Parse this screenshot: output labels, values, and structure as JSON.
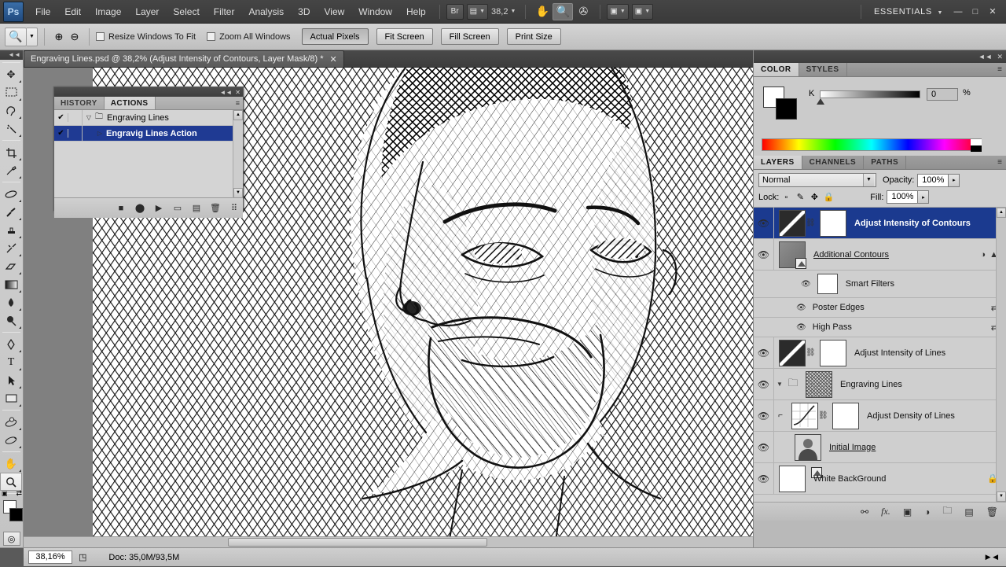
{
  "app": {
    "logo": "Ps",
    "workspace": "ESSENTIALS",
    "zoom_level_top": "38,2",
    "menus": [
      "File",
      "Edit",
      "Image",
      "Layer",
      "Select",
      "Filter",
      "Analysis",
      "3D",
      "View",
      "Window",
      "Help"
    ],
    "bridge_button": "Br",
    "window_buttons": {
      "minimize": "—",
      "maximize": "□",
      "close": "✕"
    }
  },
  "options_bar": {
    "tool": "zoom-tool",
    "checkboxes": [
      {
        "label": "Resize Windows To Fit",
        "checked": false
      },
      {
        "label": "Zoom All Windows",
        "checked": false
      }
    ],
    "buttons": [
      "Actual Pixels",
      "Fit Screen",
      "Fill Screen",
      "Print Size"
    ],
    "pressed_button": "Actual Pixels"
  },
  "document": {
    "tab_title": "Engraving Lines.psd @ 38,2% (Adjust Intensity of Contours, Layer Mask/8) *",
    "close_glyph": "✕"
  },
  "actions_panel": {
    "tabs": [
      {
        "label": "HISTORY",
        "active": false
      },
      {
        "label": "ACTIONS",
        "active": true
      }
    ],
    "rows": [
      {
        "checked": "✔",
        "label": "Engraving Lines",
        "type": "set",
        "selected": false,
        "triangle": "▽"
      },
      {
        "checked": "✔",
        "label": "Engravig Lines Action",
        "type": "action",
        "selected": true,
        "triangle": "▷"
      }
    ],
    "footer_icons": [
      "stop-icon",
      "record-icon",
      "play-icon",
      "new-set-icon",
      "new-action-icon",
      "delete-icon"
    ],
    "menu_glyph": "≡"
  },
  "color_panel": {
    "tabs": [
      {
        "label": "COLOR",
        "active": true
      },
      {
        "label": "STYLES",
        "active": false
      }
    ],
    "channel_label": "K",
    "channel_value": "0",
    "percent_symbol": "%",
    "foreground": "#ffffff",
    "background": "#000000",
    "menu_glyph": "≡"
  },
  "layers_panel": {
    "tabs": [
      {
        "label": "LAYERS",
        "active": true
      },
      {
        "label": "CHANNELS",
        "active": false
      },
      {
        "label": "PATHS",
        "active": false
      }
    ],
    "blend_mode": "Normal",
    "opacity_label": "Opacity:",
    "opacity_value": "100%",
    "lock_label": "Lock:",
    "fill_label": "Fill:",
    "fill_value": "100%",
    "lock_icons": [
      "lock-transparent-icon",
      "lock-paint-icon",
      "lock-move-icon",
      "lock-all-icon"
    ],
    "menu_glyph": "≡",
    "layers": [
      {
        "name": "Adjust Intensity of Contours",
        "kind": "adjustment",
        "selected": true,
        "visible": true,
        "has_mask": true,
        "linked": true,
        "indent": 0,
        "underline": false
      },
      {
        "name": "Additional Contours",
        "kind": "smart-object",
        "selected": false,
        "visible": true,
        "has_mask": false,
        "linked": false,
        "indent": 0,
        "underline": true,
        "right_icon": "smart-filter-icon"
      },
      {
        "name": "Smart Filters",
        "kind": "smart-filters",
        "selected": false,
        "visible": true,
        "indent": 1,
        "underline": false
      },
      {
        "name": "Poster Edges",
        "kind": "filter",
        "selected": false,
        "visible": true,
        "indent": 2,
        "underline": false,
        "right_icon": "filter-options-icon"
      },
      {
        "name": "High Pass",
        "kind": "filter",
        "selected": false,
        "visible": true,
        "indent": 2,
        "underline": false,
        "right_icon": "filter-options-icon"
      },
      {
        "name": "Adjust Intensity of Lines",
        "kind": "adjustment",
        "selected": false,
        "visible": true,
        "has_mask": true,
        "linked": true,
        "indent": 0,
        "underline": false
      },
      {
        "name": "Engraving Lines",
        "kind": "group",
        "selected": false,
        "visible": true,
        "indent": 0,
        "underline": false,
        "expanded": true
      },
      {
        "name": "Adjust Density of Lines",
        "kind": "curves",
        "selected": false,
        "visible": true,
        "has_mask": true,
        "linked": true,
        "indent": 1,
        "underline": false,
        "clipped": true
      },
      {
        "name": "Initial Image",
        "kind": "smart-object",
        "selected": false,
        "visible": true,
        "indent": 1,
        "underline": true
      },
      {
        "name": "White BackGround",
        "kind": "raster",
        "selected": false,
        "visible": true,
        "indent": 0,
        "underline": false,
        "right_icon": "lock-icon"
      }
    ],
    "footer_icons": [
      "link-layers-icon",
      "layer-style-fx-icon",
      "add-mask-icon",
      "adjustment-layer-icon",
      "new-group-icon",
      "new-layer-icon",
      "delete-layer-icon"
    ]
  },
  "toolbox": {
    "tools": [
      {
        "name": "move-tool",
        "glyph": "✥",
        "selected": false
      },
      {
        "name": "rectangular-marquee-tool",
        "glyph": "▭",
        "selected": false
      },
      {
        "name": "lasso-tool",
        "glyph": "⌇",
        "selected": false
      },
      {
        "name": "magic-wand-tool",
        "glyph": "✨",
        "selected": false
      },
      {
        "name": "crop-tool",
        "glyph": "⌗",
        "selected": false
      },
      {
        "name": "eyedropper-tool",
        "glyph": "✎",
        "selected": false
      },
      {
        "name": "spot-healing-brush-tool",
        "glyph": "⬭",
        "selected": false
      },
      {
        "name": "brush-tool",
        "glyph": "✒",
        "selected": false
      },
      {
        "name": "clone-stamp-tool",
        "glyph": "⚉",
        "selected": false
      },
      {
        "name": "history-brush-tool",
        "glyph": "⌁",
        "selected": false
      },
      {
        "name": "eraser-tool",
        "glyph": "▰",
        "selected": false
      },
      {
        "name": "gradient-tool",
        "glyph": "▭",
        "selected": false
      },
      {
        "name": "blur-tool",
        "glyph": "◉",
        "selected": false
      },
      {
        "name": "dodge-tool",
        "glyph": "●",
        "selected": false
      },
      {
        "name": "pen-tool",
        "glyph": "✑",
        "selected": false
      },
      {
        "name": "horizontal-type-tool",
        "glyph": "T",
        "selected": false
      },
      {
        "name": "path-selection-tool",
        "glyph": "➤",
        "selected": false
      },
      {
        "name": "rectangle-tool",
        "glyph": "▢",
        "selected": false
      },
      {
        "name": "3d-rotate-tool",
        "glyph": "◍",
        "selected": false
      },
      {
        "name": "3d-orbit-tool",
        "glyph": "◓",
        "selected": false
      },
      {
        "name": "hand-tool",
        "glyph": "✋",
        "selected": false
      },
      {
        "name": "zoom-tool",
        "glyph": "🔍",
        "selected": true
      }
    ],
    "foreground_color": "#ffffff",
    "background_color": "#000000",
    "quick_mask": "quick-mask-icon"
  },
  "status_bar": {
    "zoom": "38,16%",
    "doc_info": "Doc: 35,0M/93,5M"
  }
}
